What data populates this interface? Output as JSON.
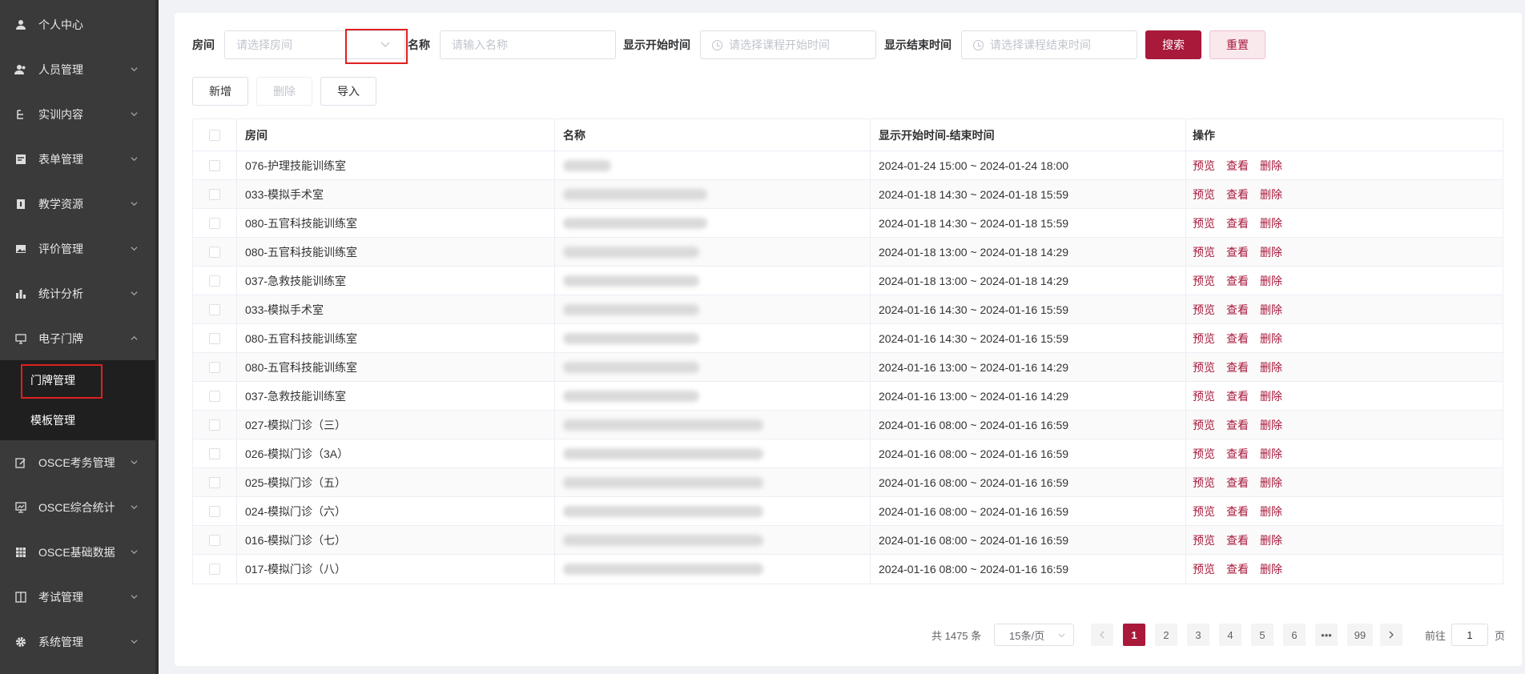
{
  "sidebar": {
    "items": [
      {
        "label": "个人中心",
        "icon": "user-icon"
      },
      {
        "label": "人员管理",
        "icon": "users-icon"
      },
      {
        "label": "实训内容",
        "icon": "tree-icon"
      },
      {
        "label": "表单管理",
        "icon": "form-icon"
      },
      {
        "label": "教学资源",
        "icon": "book-icon"
      },
      {
        "label": "评价管理",
        "icon": "image-icon"
      },
      {
        "label": "统计分析",
        "icon": "bar-chart-icon"
      },
      {
        "label": "电子门牌",
        "icon": "monitor-icon"
      },
      {
        "label": "OSCE考务管理",
        "icon": "edit-icon"
      },
      {
        "label": "OSCE综合统计",
        "icon": "screen-chart-icon"
      },
      {
        "label": "OSCE基础数据",
        "icon": "grid-icon"
      },
      {
        "label": "考试管理",
        "icon": "panel-icon"
      },
      {
        "label": "系统管理",
        "icon": "gear-icon"
      }
    ],
    "submenu": [
      {
        "label": "门牌管理"
      },
      {
        "label": "模板管理"
      }
    ]
  },
  "search": {
    "room_label": "房间",
    "room_placeholder": "请选择房间",
    "name_label": "名称",
    "name_placeholder": "请输入名称",
    "start_label": "显示开始时间",
    "start_placeholder": "请选择课程开始时间",
    "end_label": "显示结束时间",
    "end_placeholder": "请选择课程结束时间",
    "search_button": "搜索",
    "reset_button": "重置"
  },
  "toolbar": {
    "add": "新增",
    "delete": "删除",
    "import": "导入"
  },
  "table": {
    "headers": [
      "房间",
      "名称",
      "显示开始时间-结束时间",
      "操作"
    ],
    "actions": [
      "预览",
      "查看",
      "删除"
    ],
    "rows": [
      {
        "room": "076-护理技能训练室",
        "time": "2024-01-24 15:00 ~ 2024-01-24 18:00"
      },
      {
        "room": "033-模拟手术室",
        "time": "2024-01-18 14:30 ~ 2024-01-18 15:59"
      },
      {
        "room": "080-五官科技能训练室",
        "time": "2024-01-18 14:30 ~ 2024-01-18 15:59"
      },
      {
        "room": "080-五官科技能训练室",
        "time": "2024-01-18 13:00 ~ 2024-01-18 14:29"
      },
      {
        "room": "037-急救技能训练室",
        "time": "2024-01-18 13:00 ~ 2024-01-18 14:29"
      },
      {
        "room": "033-模拟手术室",
        "time": "2024-01-16 14:30 ~ 2024-01-16 15:59"
      },
      {
        "room": "080-五官科技能训练室",
        "time": "2024-01-16 14:30 ~ 2024-01-16 15:59"
      },
      {
        "room": "080-五官科技能训练室",
        "time": "2024-01-16 13:00 ~ 2024-01-16 14:29"
      },
      {
        "room": "037-急救技能训练室",
        "time": "2024-01-16 13:00 ~ 2024-01-16 14:29"
      },
      {
        "room": "027-模拟门诊（三）",
        "time": "2024-01-16 08:00 ~ 2024-01-16 16:59"
      },
      {
        "room": "026-模拟门诊（3A）",
        "time": "2024-01-16 08:00 ~ 2024-01-16 16:59"
      },
      {
        "room": "025-模拟门诊（五）",
        "time": "2024-01-16 08:00 ~ 2024-01-16 16:59"
      },
      {
        "room": "024-模拟门诊（六）",
        "time": "2024-01-16 08:00 ~ 2024-01-16 16:59"
      },
      {
        "room": "016-模拟门诊（七）",
        "time": "2024-01-16 08:00 ~ 2024-01-16 16:59"
      },
      {
        "room": "017-模拟门诊（八）",
        "time": "2024-01-16 08:00 ~ 2024-01-16 16:59"
      }
    ]
  },
  "pagination": {
    "total": "共 1475 条",
    "page_size": "15条/页",
    "pages": [
      "1",
      "2",
      "3",
      "4",
      "5",
      "6",
      "•••",
      "99"
    ],
    "goto_prefix": "前往",
    "goto_value": "1",
    "goto_suffix": "页"
  },
  "colors": {
    "accent": "#a8193a",
    "sidebar_bg": "#3a3a3a",
    "highlight": "#e02020"
  }
}
